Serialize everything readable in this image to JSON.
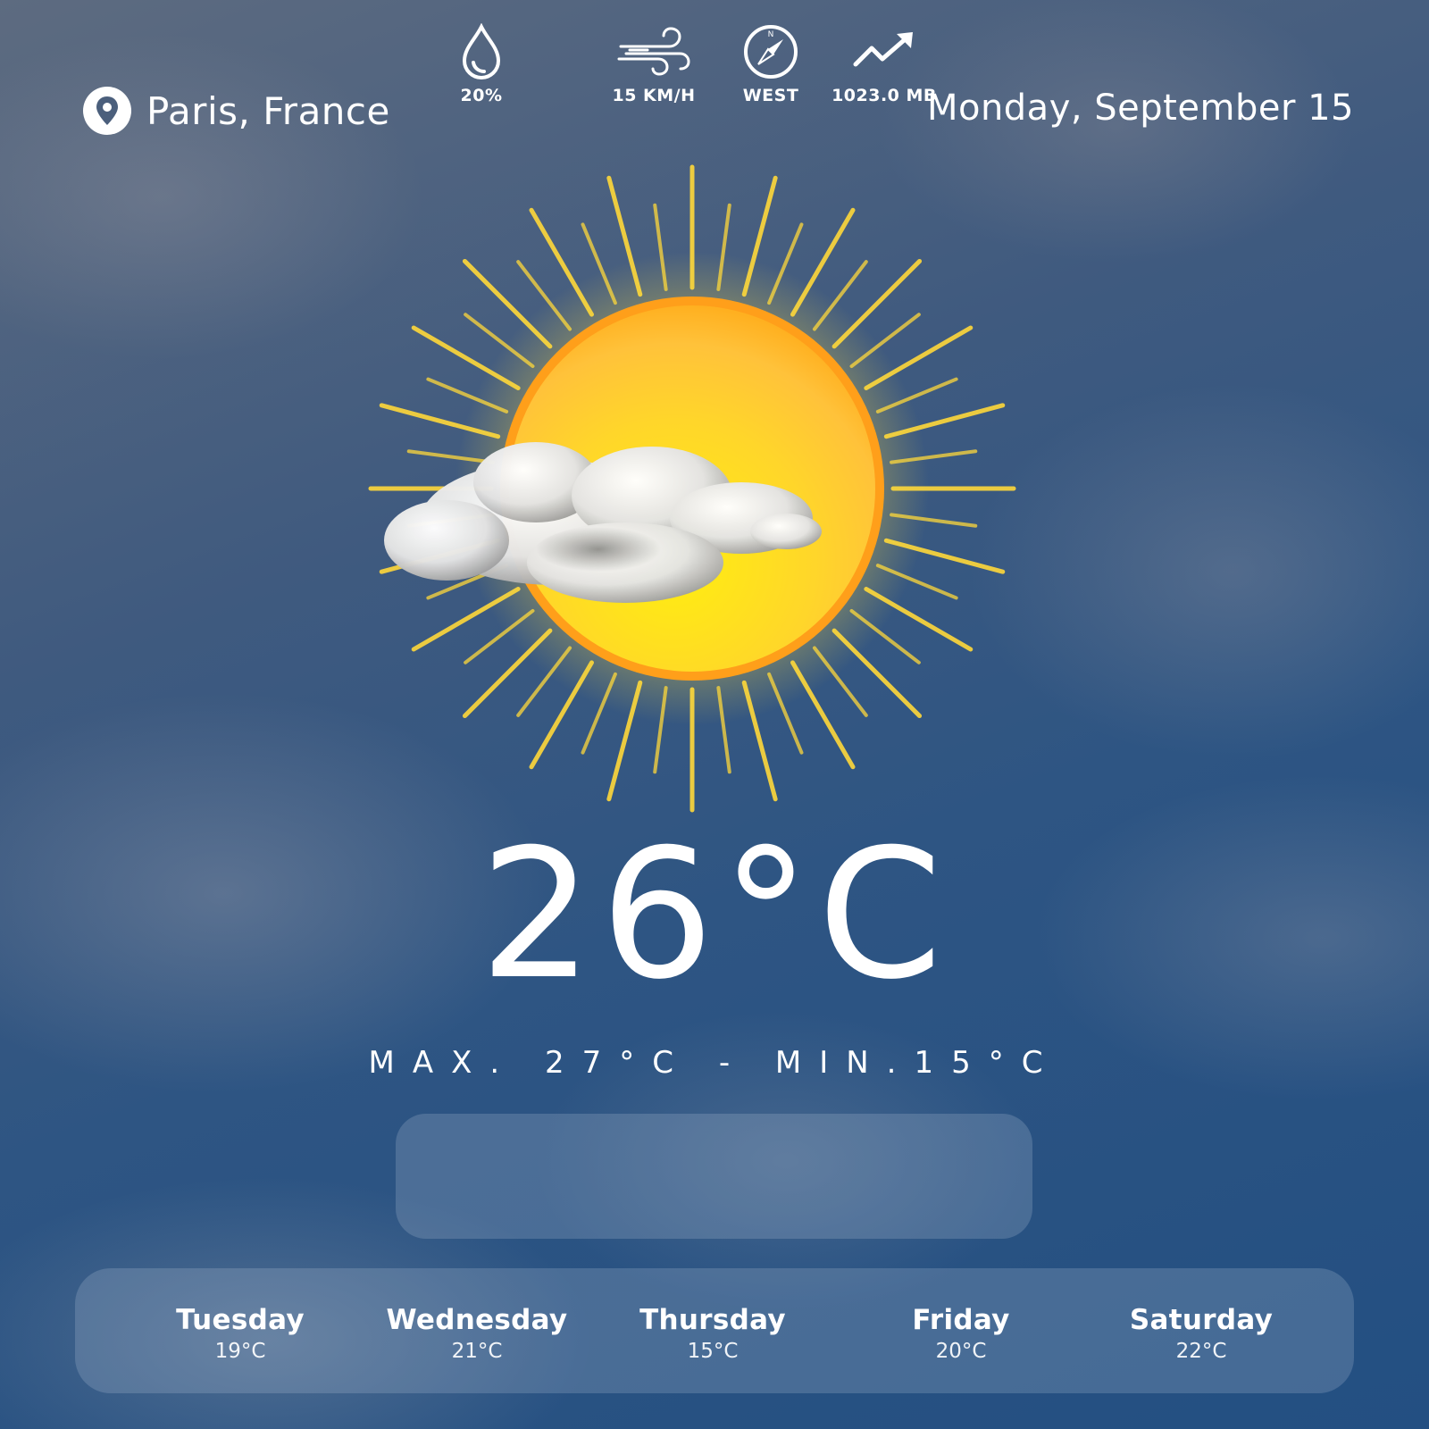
{
  "header": {
    "location": "Paris, France",
    "date": "Monday, September 15",
    "location_icon": "map-pin-icon"
  },
  "current": {
    "condition_icon": "partly-cloudy-sun-icon",
    "temperature": "26°C",
    "range": "MAX. 27°C - MIN.15°C"
  },
  "stats": [
    {
      "icon": "droplet-icon",
      "label": "20%"
    },
    {
      "icon": "wind-icon",
      "label": "15 KM/H"
    },
    {
      "icon": "compass-icon",
      "label": "WEST"
    },
    {
      "icon": "trend-up-icon",
      "label": "1023.0 MB"
    }
  ],
  "forecast": [
    {
      "day": "Tuesday",
      "temp": "19°C"
    },
    {
      "day": "Wednesday",
      "temp": "21°C"
    },
    {
      "day": "Thursday",
      "temp": "15°C"
    },
    {
      "day": "Friday",
      "temp": "20°C"
    },
    {
      "day": "Saturday",
      "temp": "22°C"
    }
  ],
  "colors": {
    "sky_top": "#5d6b80",
    "sky_bottom": "#234f82",
    "sun_core": "#ffd52a",
    "sun_rim": "#ff9f1a",
    "sun_rays": "#ffd83a",
    "text": "#ffffff",
    "panel": "rgba(190,205,225,0.22)"
  }
}
